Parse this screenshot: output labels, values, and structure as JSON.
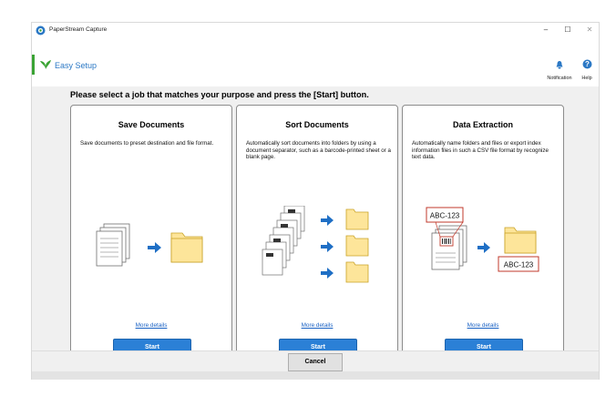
{
  "window": {
    "title": "PaperStream Capture",
    "controls": {
      "minimize": "–",
      "maximize": "☐",
      "close": "✕"
    }
  },
  "header": {
    "title": "Easy Setup",
    "notification_label": "Notification",
    "help_label": "Help"
  },
  "instruction": "Please select a job that matches your purpose and press the [Start] button.",
  "cards": [
    {
      "title": "Save Documents",
      "description": "Save documents to preset destination and file format.",
      "more_details": "More details",
      "start_label": "Start"
    },
    {
      "title": "Sort Documents",
      "description": "Automatically sort documents into folders by using a document separator, such as a barcode-printed sheet or a blank page.",
      "more_details": "More details",
      "start_label": "Start"
    },
    {
      "title": "Data Extraction",
      "description": "Automatically name folders and files or export index information files in such a CSV file format by recognize text data.",
      "more_details": "More details",
      "start_label": "Start",
      "sample_code_top": "ABC-123",
      "sample_code_folder": "ABC-123"
    }
  ],
  "footer": {
    "cancel_label": "Cancel"
  },
  "colors": {
    "accent_blue": "#2b80d6",
    "link_blue": "#1a62c4",
    "folder_fill": "#fde59a",
    "folder_stroke": "#c9a227",
    "arrow_blue": "#1f6fc5",
    "extract_red": "#c0392b",
    "leaf_green": "#3aa334"
  }
}
